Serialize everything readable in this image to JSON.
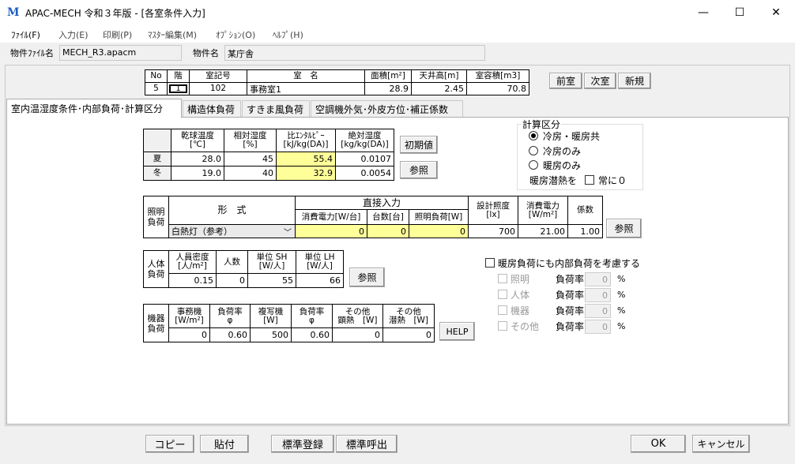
{
  "window": {
    "title": "APAC-MECH 令和３年版 - [各室条件入力]",
    "minimize": "—",
    "maximize": "☐",
    "close": "✕"
  },
  "menu": [
    "ﾌｧｲﾙ(F)",
    "入力(E)",
    "印刷(P)",
    "ﾏｽﾀｰ編集(M)",
    "ｵﾌﾟｼｮﾝ(O)",
    "ﾍﾙﾌﾟ(H)"
  ],
  "info": {
    "file_label": "物件ﾌｧｲﾙ名",
    "file_value": "MECH_R3.apacm",
    "name_label": "物件名",
    "name_value": "某庁舎"
  },
  "room": {
    "headers": [
      "No",
      "階",
      "室記号",
      "室　名",
      "面積[m²]",
      "天井高[m]",
      "室容積[m3]"
    ],
    "values": [
      "5",
      "1",
      "102",
      "事務室1",
      "28.9",
      "2.45",
      "70.8"
    ]
  },
  "nav": {
    "prev": "前室",
    "next": "次室",
    "new": "新規"
  },
  "tabs": [
    "室内温湿度条件･内部負荷･計算区分",
    "構造体負荷",
    "すきま風負荷",
    "空調機外気･外皮方位･補正係数"
  ],
  "temp": {
    "headers": [
      "乾球温度\n[℃]",
      "相対湿度\n[%]",
      "比ｴﾝﾀﾙﾋﾟｰ\n[kJ/kg(DA)]",
      "絶対湿度\n[kg/kg(DA)]"
    ],
    "rows": [
      {
        "label": "夏",
        "values": [
          "28.0",
          "45",
          "55.4",
          "0.0107"
        ]
      },
      {
        "label": "冬",
        "values": [
          "19.0",
          "40",
          "32.9",
          "0.0054"
        ]
      }
    ],
    "init_btn": "初期値",
    "ref_btn": "参照"
  },
  "calc": {
    "title": "計算区分",
    "options": [
      "冷房・暖房共",
      "冷房のみ",
      "暖房のみ"
    ],
    "selected": "冷房・暖房共",
    "latent_label": "暖房潜熱を",
    "latent_check": "常に０"
  },
  "light": {
    "side": "照明負荷",
    "form_header": "形　式",
    "direct_header": "直接入力",
    "headers": [
      "消費電力[W/台]",
      "台数[台]",
      "照明負荷[W]",
      "設計照度\n[lx]",
      "消費電力\n[W/m²]",
      "係数"
    ],
    "type": "白熱灯（参考）",
    "values": [
      "0",
      "0",
      "0",
      "700",
      "21.00",
      "1.00"
    ],
    "ref_btn": "参照"
  },
  "people": {
    "side": "人体負荷",
    "headers": [
      "人員密度\n[人/m²]",
      "人数",
      "単位 SH\n[W/人]",
      "単位 LH\n[W/人]"
    ],
    "values": [
      "0.15",
      "0",
      "55",
      "66"
    ],
    "ref_btn": "参照"
  },
  "equip": {
    "side": "機器負荷",
    "headers": [
      "事務機\n[W/m²]",
      "負荷率\nφ",
      "複写機\n[W]",
      "負荷率\nφ",
      "その他\n顕熱　[W]",
      "その他\n潜熱　[W]"
    ],
    "values": [
      "0",
      "0.60",
      "500",
      "0.60",
      "0",
      "0"
    ],
    "help_btn": "HELP"
  },
  "heating": {
    "check_label": "暖房負荷にも内部負荷を考慮する",
    "rate_label": "負荷率",
    "unit": "%",
    "items": [
      {
        "label": "照明",
        "value": "0"
      },
      {
        "label": "人体",
        "value": "0"
      },
      {
        "label": "機器",
        "value": "0"
      },
      {
        "label": "その他",
        "value": "0"
      }
    ]
  },
  "footer": {
    "copy": "コピー",
    "paste": "貼付",
    "std_save": "標準登録",
    "std_load": "標準呼出",
    "ok": "OK",
    "cancel": "キャンセル"
  },
  "colors": {
    "input_yellow": "#ffff99",
    "logo_blue": "#1e5fc0"
  }
}
